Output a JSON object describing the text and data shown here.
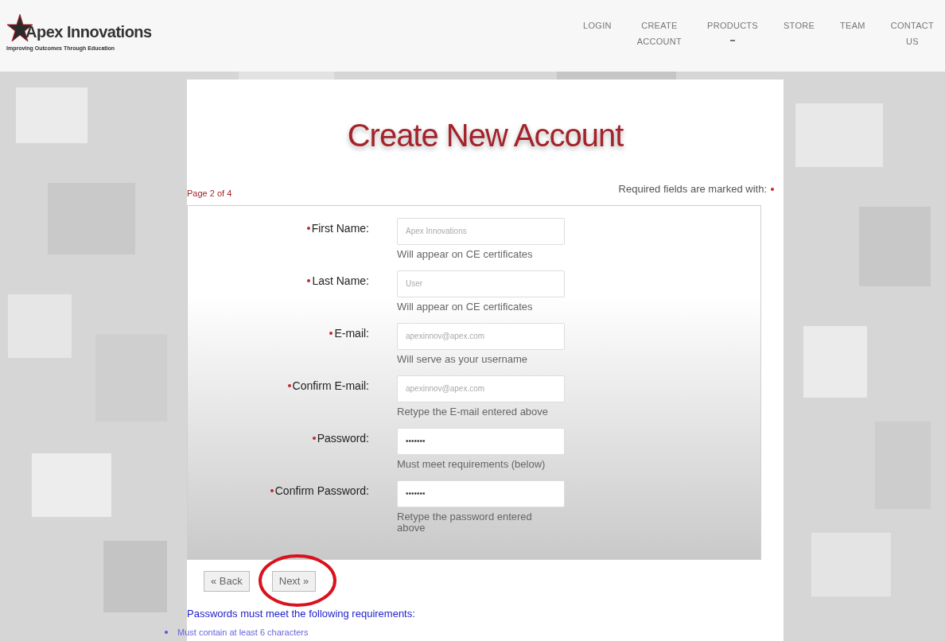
{
  "header": {
    "logo": {
      "name": "Apex Innovations",
      "tagline": "Improving Outcomes Through Education"
    },
    "nav": [
      {
        "lines": [
          "LOGIN"
        ],
        "dropdown": false
      },
      {
        "lines": [
          "CREATE",
          "ACCOUNT"
        ],
        "dropdown": false
      },
      {
        "lines": [
          "PRODUCTS"
        ],
        "dropdown": true
      },
      {
        "lines": [
          "STORE"
        ],
        "dropdown": false
      },
      {
        "lines": [
          "TEAM"
        ],
        "dropdown": false
      },
      {
        "lines": [
          "CONTACT",
          "US"
        ],
        "dropdown": false
      }
    ]
  },
  "page": {
    "title": "Create New Account",
    "step": "Page 2 of 4",
    "required_note": "Required fields are marked with:",
    "fields": [
      {
        "label": "First Name:",
        "required": true,
        "value": "Apex Innovations",
        "masked": false,
        "hint": "Will appear on CE certificates"
      },
      {
        "label": "Last Name:",
        "required": true,
        "value": "User",
        "masked": false,
        "hint": "Will appear on CE certificates"
      },
      {
        "label": "E-mail:",
        "required": true,
        "value": "apexinnov@apex.com",
        "masked": false,
        "hint": "Will serve as your username"
      },
      {
        "label": "Confirm E-mail:",
        "required": true,
        "value": "apexinnov@apex.com",
        "masked": false,
        "hint": "Retype the E-mail entered above"
      },
      {
        "label": "Password:",
        "required": true,
        "value": "•••••••",
        "masked": true,
        "hint": "Must meet requirements (below)"
      },
      {
        "label": "Confirm Password:",
        "required": true,
        "value": "•••••••",
        "masked": true,
        "hint": "Retype the password entered above"
      }
    ],
    "buttons": [
      {
        "label": "« Back",
        "highlighted": false
      },
      {
        "label": "Next »",
        "highlighted": true
      }
    ],
    "requirements": {
      "heading": "Passwords must meet the following requirements:",
      "items": [
        "Must contain at least 6 characters"
      ]
    }
  }
}
